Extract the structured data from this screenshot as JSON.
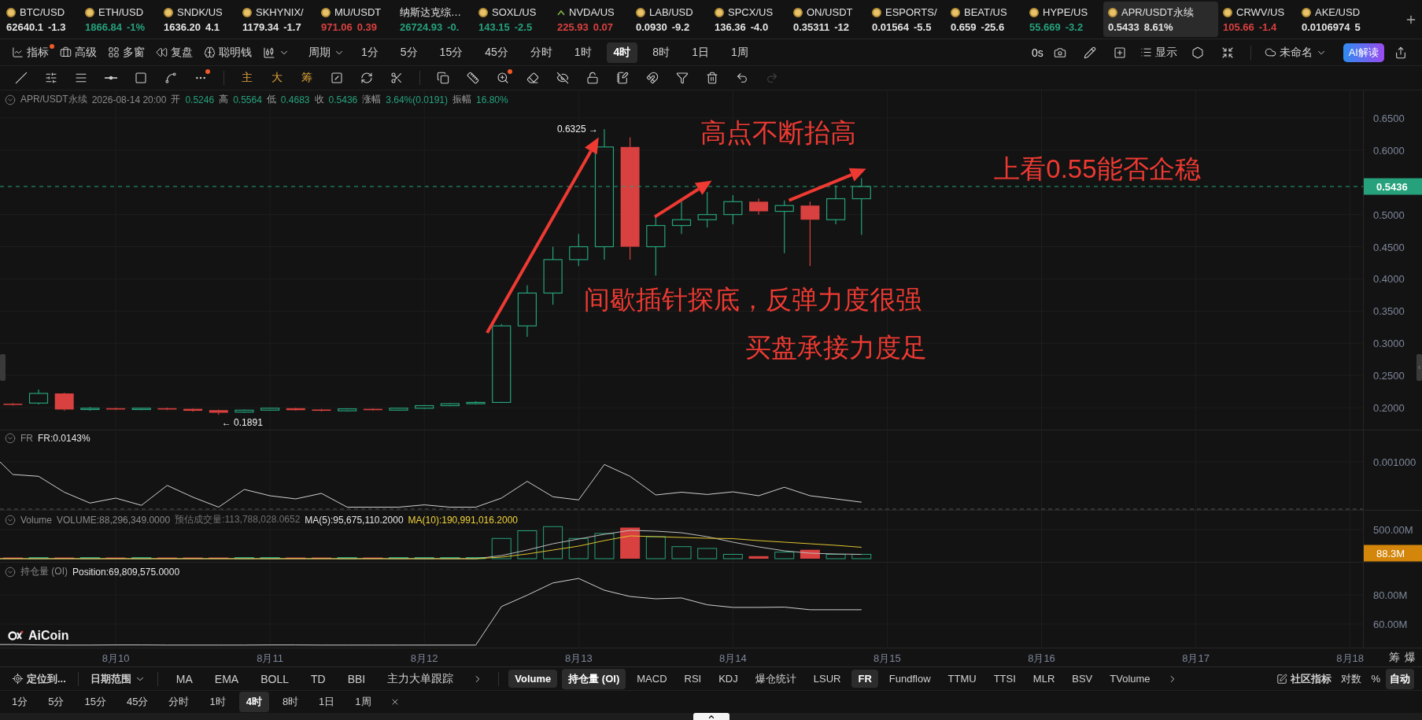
{
  "tickers": [
    {
      "kind": "coin",
      "symbol": "BTC/USD",
      "price": "62640.1",
      "change": "-1.3",
      "color": "#e4e4e4",
      "selected": false
    },
    {
      "kind": "coin",
      "symbol": "ETH/USD",
      "price": "1866.84",
      "change": "-1%",
      "color": "#26a17b",
      "selected": false
    },
    {
      "kind": "coin",
      "symbol": "SNDK/US",
      "price": "1636.20",
      "change": "4.1",
      "color": "#e4e4e4",
      "selected": false
    },
    {
      "kind": "coin",
      "symbol": "SKHYNIX/",
      "price": "1179.34",
      "change": "-1.7",
      "color": "#e4e4e4",
      "selected": false
    },
    {
      "kind": "coin",
      "symbol": "MU/USDT",
      "price": "971.06",
      "change": "0.39",
      "color": "#d8413f",
      "selected": false
    },
    {
      "kind": "index",
      "symbol": "纳斯达克综…",
      "price": "26724.93",
      "change": "-0.",
      "color": "#26a17b",
      "selected": false
    },
    {
      "kind": "coin",
      "symbol": "SOXL/US",
      "price": "143.15",
      "change": "-2.5",
      "color": "#26a17b",
      "selected": false
    },
    {
      "kind": "stock",
      "symbol": "NVDA/US",
      "price": "225.93",
      "change": "0.07",
      "color": "#d8413f",
      "selected": false
    },
    {
      "kind": "coin",
      "symbol": "LAB/USD",
      "price": "0.0930",
      "change": "-9.2",
      "color": "#e4e4e4",
      "selected": false
    },
    {
      "kind": "coin",
      "symbol": "SPCX/US",
      "price": "136.36",
      "change": "-4.0",
      "color": "#e4e4e4",
      "selected": false
    },
    {
      "kind": "coin",
      "symbol": "ON/USDT",
      "price": "0.35311",
      "change": "-12",
      "color": "#e4e4e4",
      "selected": false
    },
    {
      "kind": "coin",
      "symbol": "ESPORTS/",
      "price": "0.01564",
      "change": "-5.5",
      "color": "#e4e4e4",
      "selected": false
    },
    {
      "kind": "coin",
      "symbol": "BEAT/US",
      "price": "0.659",
      "change": "-25.6",
      "color": "#e4e4e4",
      "selected": false
    },
    {
      "kind": "coin",
      "symbol": "HYPE/US",
      "price": "55.669",
      "change": "-3.2",
      "color": "#26a17b",
      "selected": false
    },
    {
      "kind": "coin",
      "symbol": "APR/USDT永续",
      "price": "0.5433",
      "change": "8.61%",
      "color": "#e4e4e4",
      "selected": true
    },
    {
      "kind": "coin",
      "symbol": "CRWV/US",
      "price": "105.66",
      "change": "-1.4",
      "color": "#d8413f",
      "selected": false
    },
    {
      "kind": "coin",
      "symbol": "AKE/USD",
      "price": "0.0106974",
      "change": "5",
      "color": "#e4e4e4",
      "selected": false
    }
  ],
  "toolbar": {
    "tools": [
      {
        "kind": "indicator",
        "label": "指标",
        "badge": true
      },
      {
        "kind": "advanced",
        "label": "高级",
        "badge": false
      },
      {
        "kind": "multi-window",
        "label": "多窗",
        "badge": false
      },
      {
        "kind": "replay",
        "label": "复盘",
        "badge": false
      },
      {
        "kind": "smart-money",
        "label": "聪明钱",
        "badge": false
      }
    ],
    "period_label": "周期",
    "periods": [
      {
        "label": "1分",
        "selected": false
      },
      {
        "label": "5分",
        "selected": false
      },
      {
        "label": "15分",
        "selected": false
      },
      {
        "label": "45分",
        "selected": false
      },
      {
        "label": "分时",
        "selected": false
      },
      {
        "label": "1时",
        "selected": false
      },
      {
        "label": "4时",
        "selected": true
      },
      {
        "label": "8时",
        "selected": false
      },
      {
        "label": "1日",
        "selected": false
      },
      {
        "label": "1周",
        "selected": false
      }
    ],
    "countdown": "0s",
    "display_label": "显示",
    "layout_name": "未命名",
    "ai_button": "AI解读"
  },
  "drawing_tools": [
    {
      "kind": "line",
      "badge": false,
      "disabled": false
    },
    {
      "kind": "parallel",
      "badge": false,
      "disabled": false
    },
    {
      "kind": "lines",
      "badge": false,
      "disabled": false
    },
    {
      "kind": "hline",
      "badge": false,
      "disabled": false
    },
    {
      "kind": "rect",
      "badge": false,
      "disabled": false
    },
    {
      "kind": "fib",
      "badge": false,
      "disabled": false
    },
    {
      "kind": "more",
      "badge": true,
      "disabled": false
    },
    {
      "kind": "box",
      "badge": false,
      "disabled": false
    },
    {
      "kind": "swap",
      "badge": false,
      "disabled": false
    },
    {
      "kind": "measure",
      "badge": false,
      "disabled": false
    },
    {
      "kind": "copy",
      "badge": false,
      "disabled": false
    },
    {
      "kind": "ruler",
      "badge": false,
      "disabled": false
    },
    {
      "kind": "zoom",
      "badge": true,
      "disabled": false
    },
    {
      "kind": "eraser",
      "badge": false,
      "disabled": false
    },
    {
      "kind": "hide",
      "badge": false,
      "disabled": false
    },
    {
      "kind": "lock",
      "badge": false,
      "disabled": false
    },
    {
      "kind": "note",
      "badge": false,
      "disabled": false
    },
    {
      "kind": "magnet",
      "badge": false,
      "disabled": false
    },
    {
      "kind": "filter",
      "badge": false,
      "disabled": false
    },
    {
      "kind": "trash",
      "badge": false,
      "disabled": false
    },
    {
      "kind": "undo",
      "badge": false,
      "disabled": false
    },
    {
      "kind": "redo",
      "badge": false,
      "disabled": true
    }
  ],
  "chart_styles": [
    "主",
    "大",
    "筹"
  ],
  "main_chart": {
    "symbol": "APR/USDT永续",
    "time": "2026-08-14 20:00",
    "fields": [
      {
        "label": "开",
        "value": "0.5246"
      },
      {
        "label": "高",
        "value": "0.5564"
      },
      {
        "label": "低",
        "value": "0.4683"
      },
      {
        "label": "收",
        "value": "0.5436"
      },
      {
        "label": "涨幅",
        "value": "3.64%(0.0191)"
      },
      {
        "label": "振幅",
        "value": "16.80%"
      }
    ],
    "axis_labels": [
      "0.6500",
      "0.6000",
      "0.5000",
      "0.4500",
      "0.4000",
      "0.3500",
      "0.3000",
      "0.2500",
      "0.2000"
    ],
    "price_tag": "0.5436",
    "high_label": "0.6325 →",
    "low_label": "← 0.1891",
    "notes": [
      "高点不断抬高",
      "上看0.55能否企稳",
      "间歇插针探底，反弹力度很强",
      "买盘承接力度足"
    ]
  },
  "fr_pane": {
    "name": "FR",
    "readout": "FR:0.0143%",
    "axis_label": "0.001000"
  },
  "volume_pane": {
    "name": "Volume",
    "readouts": [
      {
        "text": "VOLUME:88,296,349.0000",
        "color": "#8a8a8a"
      },
      {
        "text": "预估成交量:113,788,028.0652",
        "color": "#6f6f6f"
      },
      {
        "text": "MA(5):95,675,110.2000",
        "color": "#e6e6e6"
      },
      {
        "text": "MA(10):190,991,016.2000",
        "color": "#f2d43c"
      }
    ],
    "axis_label": "500.00M",
    "value_tag": "88.3M"
  },
  "oi_pane": {
    "name": "持仓量 (OI)",
    "readout": "Position:69,809,575.0000",
    "axis_labels": [
      "80.00M",
      "60.00M"
    ]
  },
  "logo": "AiCoin",
  "date_labels": [
    "8月10",
    "8月11",
    "8月12",
    "8月13",
    "8月14",
    "8月15",
    "8月16",
    "8月17",
    "8月18"
  ],
  "axis_corner": [
    "筹",
    "爆"
  ],
  "bottom_bar": {
    "locate": "定位到...",
    "date_range": "日期范围",
    "main_indicators": [
      "MA",
      "EMA",
      "BOLL",
      "TD",
      "BBI",
      "主力大单跟踪"
    ],
    "sub_indicators": [
      {
        "label": "Volume",
        "selected": true
      },
      {
        "label": "持仓量 (OI)",
        "selected": true
      },
      {
        "label": "MACD",
        "selected": false
      },
      {
        "label": "RSI",
        "selected": false
      },
      {
        "label": "KDJ",
        "selected": false
      },
      {
        "label": "爆仓统计",
        "selected": false
      },
      {
        "label": "LSUR",
        "selected": false
      },
      {
        "label": "FR",
        "selected": true
      },
      {
        "label": "Fundflow",
        "selected": false
      },
      {
        "label": "TTMU",
        "selected": false
      },
      {
        "label": "TTSI",
        "selected": false
      },
      {
        "label": "MLR",
        "selected": false
      },
      {
        "label": "BSV",
        "selected": false
      },
      {
        "label": "TVolume",
        "selected": false
      }
    ],
    "community": "社区指标",
    "options": [
      {
        "label": "对数",
        "selected": false
      },
      {
        "label": "%",
        "selected": false
      },
      {
        "label": "自动",
        "selected": true
      }
    ]
  },
  "bottom_periods": [
    {
      "label": "1分",
      "selected": false
    },
    {
      "label": "5分",
      "selected": false
    },
    {
      "label": "15分",
      "selected": false
    },
    {
      "label": "45分",
      "selected": false
    },
    {
      "label": "分时",
      "selected": false
    },
    {
      "label": "1时",
      "selected": false
    },
    {
      "label": "4时",
      "selected": true
    },
    {
      "label": "8时",
      "selected": false
    },
    {
      "label": "1日",
      "selected": false
    },
    {
      "label": "1周",
      "selected": false
    }
  ]
}
